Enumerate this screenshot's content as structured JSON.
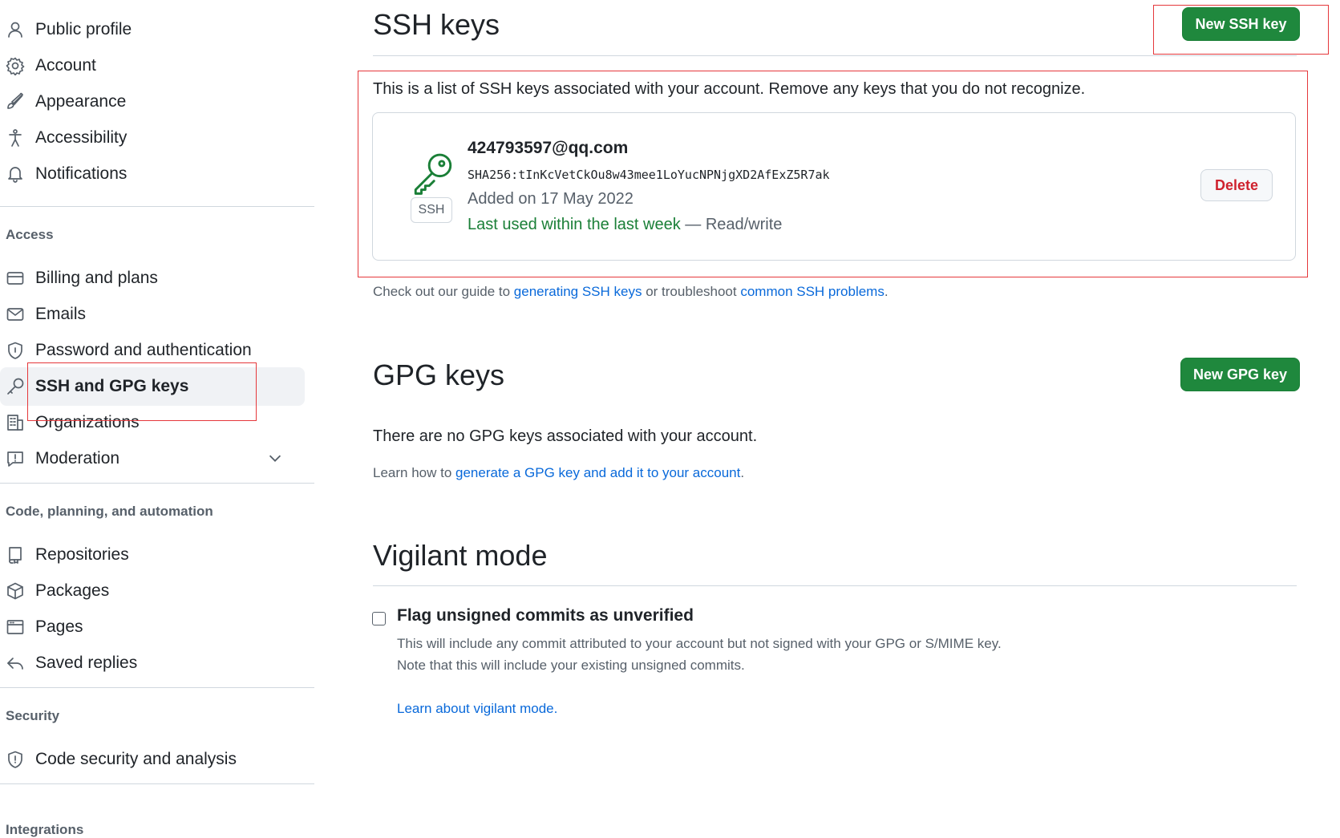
{
  "sidebar": {
    "items_top": [
      {
        "label": "Public profile",
        "icon": "person-icon"
      },
      {
        "label": "Account",
        "icon": "gear-icon"
      },
      {
        "label": "Appearance",
        "icon": "paintbrush-icon"
      },
      {
        "label": "Accessibility",
        "icon": "accessibility-icon"
      },
      {
        "label": "Notifications",
        "icon": "bell-icon"
      }
    ],
    "access_heading": "Access",
    "items_access": [
      {
        "label": "Billing and plans",
        "icon": "credit-card-icon"
      },
      {
        "label": "Emails",
        "icon": "mail-icon"
      },
      {
        "label": "Password and authentication",
        "icon": "shield-lock-icon"
      },
      {
        "label": "SSH and GPG keys",
        "icon": "key-icon"
      },
      {
        "label": "Organizations",
        "icon": "organization-icon"
      },
      {
        "label": "Moderation",
        "icon": "report-icon"
      }
    ],
    "code_heading": "Code, planning, and automation",
    "items_code": [
      {
        "label": "Repositories",
        "icon": "repo-icon"
      },
      {
        "label": "Packages",
        "icon": "package-icon"
      },
      {
        "label": "Pages",
        "icon": "browser-icon"
      },
      {
        "label": "Saved replies",
        "icon": "reply-icon"
      }
    ],
    "security_heading": "Security",
    "items_security": [
      {
        "label": "Code security and analysis",
        "icon": "shield-icon"
      }
    ],
    "integrations_heading": "Integrations"
  },
  "ssh": {
    "title": "SSH keys",
    "new_button": "New SSH key",
    "description": "This is a list of SSH keys associated with your account. Remove any keys that you do not recognize.",
    "key": {
      "badge": "SSH",
      "title": "424793597@qq.com",
      "fingerprint": "SHA256:tInKcVetCkOu8w43mee1LoYucNPNjgXD2AfExZ5R7ak",
      "added": "Added on 17 May 2022",
      "last_used": "Last used within the last week",
      "access": " — Read/write",
      "delete_label": "Delete"
    },
    "guide_prefix": "Check out our guide to ",
    "guide_link1": "generating SSH keys",
    "guide_mid": " or troubleshoot ",
    "guide_link2": "common SSH problems",
    "guide_suffix": "."
  },
  "gpg": {
    "title": "GPG keys",
    "new_button": "New GPG key",
    "empty_text": "There are no GPG keys associated with your account.",
    "learn_prefix": "Learn how to ",
    "learn_link": "generate a GPG key and add it to your account",
    "learn_suffix": "."
  },
  "vigilant": {
    "title": "Vigilant mode",
    "checkbox_label": "Flag unsigned commits as unverified",
    "checked": false,
    "desc1": "This will include any commit attributed to your account but not signed with your GPG or S/MIME key.",
    "desc2": "Note that this will include your existing unsigned commits.",
    "learn_link": "Learn about vigilant mode",
    "learn_suffix": "."
  },
  "colors": {
    "accent_green": "#1f883d",
    "link_blue": "#0969da",
    "danger": "#cf222e",
    "highlight_red": "#e5383b"
  }
}
